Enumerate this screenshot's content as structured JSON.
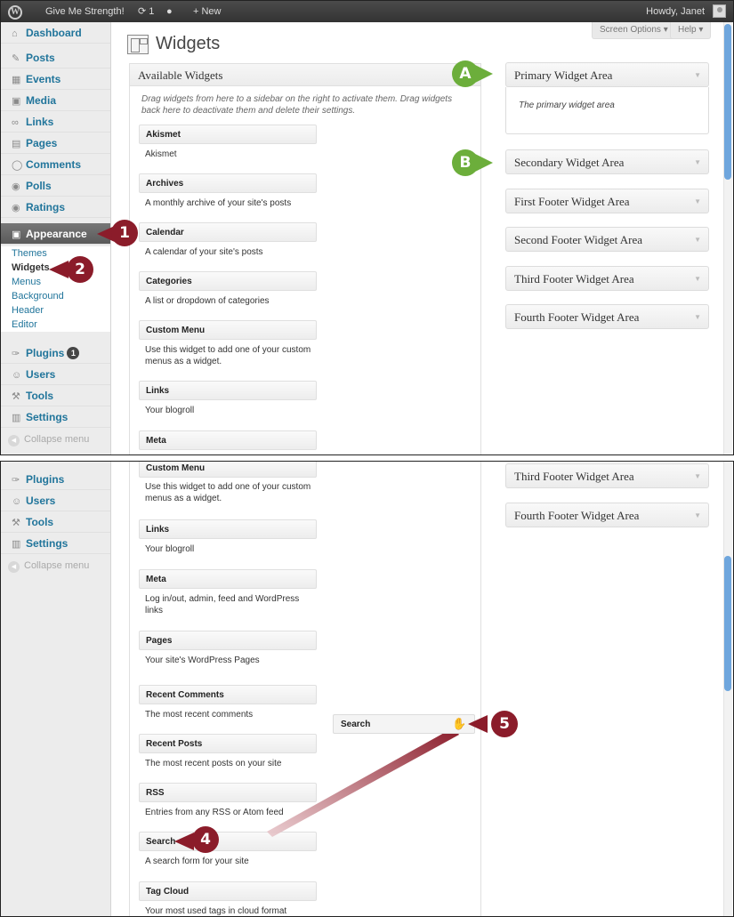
{
  "adminbar": {
    "site_name": "Give Me Strength!",
    "updates_count": "1",
    "new_label": "+ New",
    "howdy": "Howdy, Janet"
  },
  "tabs": {
    "screen_options": "Screen Options ▾",
    "help": "Help ▾"
  },
  "page_title": "Widgets",
  "menu": {
    "dashboard": "Dashboard",
    "posts": "Posts",
    "events": "Events",
    "media": "Media",
    "links": "Links",
    "pages": "Pages",
    "comments": "Comments",
    "polls": "Polls",
    "ratings": "Ratings",
    "appearance": "Appearance",
    "sub_themes": "Themes",
    "sub_widgets": "Widgets",
    "sub_menus": "Menus",
    "sub_background": "Background",
    "sub_header": "Header",
    "sub_editor": "Editor",
    "plugins": "Plugins",
    "plugins_badge": "1",
    "users": "Users",
    "tools": "Tools",
    "settings": "Settings",
    "collapse": "Collapse menu"
  },
  "available": {
    "title": "Available Widgets",
    "desc": "Drag widgets from here to a sidebar on the right to activate them. Drag widgets back here to deactivate them and delete their settings."
  },
  "widgets": [
    {
      "name": "Akismet",
      "desc": "Akismet"
    },
    {
      "name": "Archives",
      "desc": "A monthly archive of your site's posts"
    },
    {
      "name": "Calendar",
      "desc": "A calendar of your site's posts"
    },
    {
      "name": "Categories",
      "desc": "A list or dropdown of categories"
    },
    {
      "name": "Custom Menu",
      "desc": "Use this widget to add one of your custom menus as a widget."
    },
    {
      "name": "Links",
      "desc": "Your blogroll"
    },
    {
      "name": "Meta",
      "desc": "Log in/out, admin, feed and WordPress links"
    },
    {
      "name": "Pages",
      "desc": "Your site's WordPress Pages"
    },
    {
      "name": "Recent Comments",
      "desc": "The most recent comments"
    },
    {
      "name": "Recent Posts",
      "desc": "The most recent posts on your site"
    },
    {
      "name": "RSS",
      "desc": "Entries from any RSS or Atom feed"
    },
    {
      "name": "Search",
      "desc": "A search form for your site"
    },
    {
      "name": "Tag Cloud",
      "desc": "Your most used tags in cloud format"
    }
  ],
  "sidebars": {
    "primary": "Primary Widget Area",
    "primary_desc": "The primary widget area",
    "secondary": "Secondary Widget Area",
    "footer1": "First Footer Widget Area",
    "footer2": "Second Footer Widget Area",
    "footer3": "Third Footer Widget Area",
    "footer4": "Fourth Footer Widget Area"
  },
  "dragging_widget": "Search",
  "callouts": {
    "one": "1",
    "two": "2",
    "four": "4",
    "five": "5",
    "a": "A",
    "b": "B"
  },
  "colors": {
    "callout_red": "#8b1c2a",
    "callout_green": "#6cae3b",
    "link_blue": "#21759b"
  }
}
